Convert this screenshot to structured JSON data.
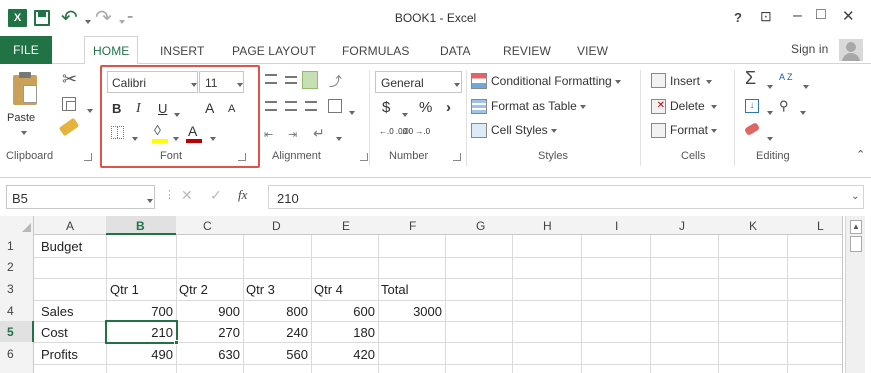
{
  "window": {
    "title": "BOOK1 - Excel",
    "help": "?",
    "restore_ribbon": "⊡",
    "minimize": "–",
    "maximize": "□",
    "close": "✕"
  },
  "tabs": [
    "FILE",
    "HOME",
    "INSERT",
    "PAGE LAYOUT",
    "FORMULAS",
    "DATA",
    "REVIEW",
    "VIEW"
  ],
  "signin": "Sign in",
  "ribbon": {
    "clipboard": {
      "label": "Clipboard",
      "paste": "Paste"
    },
    "font": {
      "label": "Font",
      "family": "Calibri",
      "size": "11",
      "bold": "B",
      "italic": "I",
      "underline": "U",
      "grow": "A",
      "shrink": "A"
    },
    "alignment": {
      "label": "Alignment"
    },
    "number": {
      "label": "Number",
      "format": "General",
      "currency": "$",
      "percent": "%",
      "comma": "›",
      "inc_decimal": "←.0 .00",
      "dec_decimal": ".00 →.0"
    },
    "styles": {
      "label": "Styles",
      "conditional": "Conditional Formatting",
      "format_table": "Format as Table",
      "cell_styles": "Cell Styles"
    },
    "cells": {
      "label": "Cells",
      "insert": "Insert",
      "delete": "Delete",
      "format": "Format"
    },
    "editing": {
      "label": "Editing",
      "sum": "Σ",
      "sort": "A Z",
      "find": "🔍"
    },
    "highlight_color": "#e0524a"
  },
  "formula_bar": {
    "name_box": "B5",
    "fx": "fx",
    "value": "210"
  },
  "sheet": {
    "columns": [
      "A",
      "B",
      "C",
      "D",
      "E",
      "F",
      "G",
      "H",
      "I",
      "J",
      "K",
      "L"
    ],
    "rows": [
      "1",
      "2",
      "3",
      "4",
      "5",
      "6"
    ],
    "active_cell": "B5",
    "cells": {
      "A1": "Budget",
      "B3": "Qtr 1",
      "C3": "Qtr 2",
      "D3": "Qtr 3",
      "E3": "Qtr 4",
      "F3": "Total",
      "A4": "Sales",
      "B4": "700",
      "C4": "900",
      "D4": "800",
      "E4": "600",
      "F4": "3000",
      "A5": "Cost",
      "B5": "210",
      "C5": "270",
      "D5": "240",
      "E5": "180",
      "A6": "Profits",
      "B6": "490",
      "C6": "630",
      "D6": "560",
      "E6": "420"
    }
  },
  "colors": {
    "excel_green": "#217346",
    "accent_red": "#e0524a",
    "font_red": "#c00000",
    "highlight_yellow": "#ffff00"
  }
}
